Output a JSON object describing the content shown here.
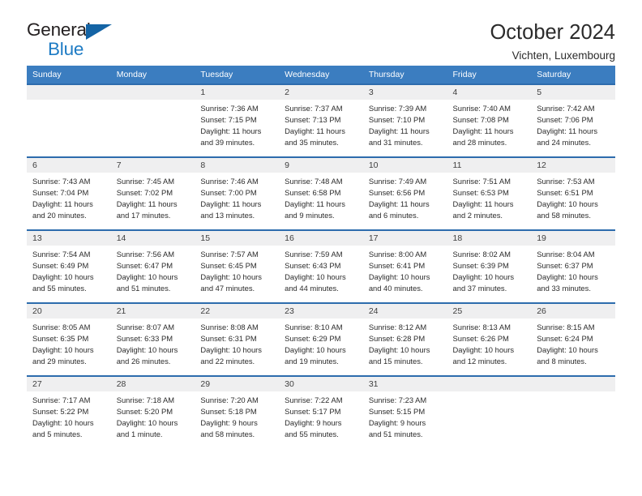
{
  "brand": {
    "name_part1": "General",
    "name_part2": "Blue",
    "triangle_icon": "triangle-icon",
    "accent_color": "#1e7bc4"
  },
  "header": {
    "title": "October 2024",
    "subtitle": "Vichten, Luxembourg"
  },
  "colors": {
    "header_row_bg": "#3b7dc0",
    "row_border": "#2d6cad",
    "daynum_band_bg": "#efeff0",
    "text": "#2b2b2b"
  },
  "weekday_headers": [
    "Sunday",
    "Monday",
    "Tuesday",
    "Wednesday",
    "Thursday",
    "Friday",
    "Saturday"
  ],
  "weeks": [
    [
      {
        "day": "",
        "sunrise": "",
        "sunset": "",
        "daylight_line1": "",
        "daylight_line2": ""
      },
      {
        "day": "",
        "sunrise": "",
        "sunset": "",
        "daylight_line1": "",
        "daylight_line2": ""
      },
      {
        "day": "1",
        "sunrise": "Sunrise: 7:36 AM",
        "sunset": "Sunset: 7:15 PM",
        "daylight_line1": "Daylight: 11 hours",
        "daylight_line2": "and 39 minutes."
      },
      {
        "day": "2",
        "sunrise": "Sunrise: 7:37 AM",
        "sunset": "Sunset: 7:13 PM",
        "daylight_line1": "Daylight: 11 hours",
        "daylight_line2": "and 35 minutes."
      },
      {
        "day": "3",
        "sunrise": "Sunrise: 7:39 AM",
        "sunset": "Sunset: 7:10 PM",
        "daylight_line1": "Daylight: 11 hours",
        "daylight_line2": "and 31 minutes."
      },
      {
        "day": "4",
        "sunrise": "Sunrise: 7:40 AM",
        "sunset": "Sunset: 7:08 PM",
        "daylight_line1": "Daylight: 11 hours",
        "daylight_line2": "and 28 minutes."
      },
      {
        "day": "5",
        "sunrise": "Sunrise: 7:42 AM",
        "sunset": "Sunset: 7:06 PM",
        "daylight_line1": "Daylight: 11 hours",
        "daylight_line2": "and 24 minutes."
      }
    ],
    [
      {
        "day": "6",
        "sunrise": "Sunrise: 7:43 AM",
        "sunset": "Sunset: 7:04 PM",
        "daylight_line1": "Daylight: 11 hours",
        "daylight_line2": "and 20 minutes."
      },
      {
        "day": "7",
        "sunrise": "Sunrise: 7:45 AM",
        "sunset": "Sunset: 7:02 PM",
        "daylight_line1": "Daylight: 11 hours",
        "daylight_line2": "and 17 minutes."
      },
      {
        "day": "8",
        "sunrise": "Sunrise: 7:46 AM",
        "sunset": "Sunset: 7:00 PM",
        "daylight_line1": "Daylight: 11 hours",
        "daylight_line2": "and 13 minutes."
      },
      {
        "day": "9",
        "sunrise": "Sunrise: 7:48 AM",
        "sunset": "Sunset: 6:58 PM",
        "daylight_line1": "Daylight: 11 hours",
        "daylight_line2": "and 9 minutes."
      },
      {
        "day": "10",
        "sunrise": "Sunrise: 7:49 AM",
        "sunset": "Sunset: 6:56 PM",
        "daylight_line1": "Daylight: 11 hours",
        "daylight_line2": "and 6 minutes."
      },
      {
        "day": "11",
        "sunrise": "Sunrise: 7:51 AM",
        "sunset": "Sunset: 6:53 PM",
        "daylight_line1": "Daylight: 11 hours",
        "daylight_line2": "and 2 minutes."
      },
      {
        "day": "12",
        "sunrise": "Sunrise: 7:53 AM",
        "sunset": "Sunset: 6:51 PM",
        "daylight_line1": "Daylight: 10 hours",
        "daylight_line2": "and 58 minutes."
      }
    ],
    [
      {
        "day": "13",
        "sunrise": "Sunrise: 7:54 AM",
        "sunset": "Sunset: 6:49 PM",
        "daylight_line1": "Daylight: 10 hours",
        "daylight_line2": "and 55 minutes."
      },
      {
        "day": "14",
        "sunrise": "Sunrise: 7:56 AM",
        "sunset": "Sunset: 6:47 PM",
        "daylight_line1": "Daylight: 10 hours",
        "daylight_line2": "and 51 minutes."
      },
      {
        "day": "15",
        "sunrise": "Sunrise: 7:57 AM",
        "sunset": "Sunset: 6:45 PM",
        "daylight_line1": "Daylight: 10 hours",
        "daylight_line2": "and 47 minutes."
      },
      {
        "day": "16",
        "sunrise": "Sunrise: 7:59 AM",
        "sunset": "Sunset: 6:43 PM",
        "daylight_line1": "Daylight: 10 hours",
        "daylight_line2": "and 44 minutes."
      },
      {
        "day": "17",
        "sunrise": "Sunrise: 8:00 AM",
        "sunset": "Sunset: 6:41 PM",
        "daylight_line1": "Daylight: 10 hours",
        "daylight_line2": "and 40 minutes."
      },
      {
        "day": "18",
        "sunrise": "Sunrise: 8:02 AM",
        "sunset": "Sunset: 6:39 PM",
        "daylight_line1": "Daylight: 10 hours",
        "daylight_line2": "and 37 minutes."
      },
      {
        "day": "19",
        "sunrise": "Sunrise: 8:04 AM",
        "sunset": "Sunset: 6:37 PM",
        "daylight_line1": "Daylight: 10 hours",
        "daylight_line2": "and 33 minutes."
      }
    ],
    [
      {
        "day": "20",
        "sunrise": "Sunrise: 8:05 AM",
        "sunset": "Sunset: 6:35 PM",
        "daylight_line1": "Daylight: 10 hours",
        "daylight_line2": "and 29 minutes."
      },
      {
        "day": "21",
        "sunrise": "Sunrise: 8:07 AM",
        "sunset": "Sunset: 6:33 PM",
        "daylight_line1": "Daylight: 10 hours",
        "daylight_line2": "and 26 minutes."
      },
      {
        "day": "22",
        "sunrise": "Sunrise: 8:08 AM",
        "sunset": "Sunset: 6:31 PM",
        "daylight_line1": "Daylight: 10 hours",
        "daylight_line2": "and 22 minutes."
      },
      {
        "day": "23",
        "sunrise": "Sunrise: 8:10 AM",
        "sunset": "Sunset: 6:29 PM",
        "daylight_line1": "Daylight: 10 hours",
        "daylight_line2": "and 19 minutes."
      },
      {
        "day": "24",
        "sunrise": "Sunrise: 8:12 AM",
        "sunset": "Sunset: 6:28 PM",
        "daylight_line1": "Daylight: 10 hours",
        "daylight_line2": "and 15 minutes."
      },
      {
        "day": "25",
        "sunrise": "Sunrise: 8:13 AM",
        "sunset": "Sunset: 6:26 PM",
        "daylight_line1": "Daylight: 10 hours",
        "daylight_line2": "and 12 minutes."
      },
      {
        "day": "26",
        "sunrise": "Sunrise: 8:15 AM",
        "sunset": "Sunset: 6:24 PM",
        "daylight_line1": "Daylight: 10 hours",
        "daylight_line2": "and 8 minutes."
      }
    ],
    [
      {
        "day": "27",
        "sunrise": "Sunrise: 7:17 AM",
        "sunset": "Sunset: 5:22 PM",
        "daylight_line1": "Daylight: 10 hours",
        "daylight_line2": "and 5 minutes."
      },
      {
        "day": "28",
        "sunrise": "Sunrise: 7:18 AM",
        "sunset": "Sunset: 5:20 PM",
        "daylight_line1": "Daylight: 10 hours",
        "daylight_line2": "and 1 minute."
      },
      {
        "day": "29",
        "sunrise": "Sunrise: 7:20 AM",
        "sunset": "Sunset: 5:18 PM",
        "daylight_line1": "Daylight: 9 hours",
        "daylight_line2": "and 58 minutes."
      },
      {
        "day": "30",
        "sunrise": "Sunrise: 7:22 AM",
        "sunset": "Sunset: 5:17 PM",
        "daylight_line1": "Daylight: 9 hours",
        "daylight_line2": "and 55 minutes."
      },
      {
        "day": "31",
        "sunrise": "Sunrise: 7:23 AM",
        "sunset": "Sunset: 5:15 PM",
        "daylight_line1": "Daylight: 9 hours",
        "daylight_line2": "and 51 minutes."
      },
      {
        "day": "",
        "sunrise": "",
        "sunset": "",
        "daylight_line1": "",
        "daylight_line2": ""
      },
      {
        "day": "",
        "sunrise": "",
        "sunset": "",
        "daylight_line1": "",
        "daylight_line2": ""
      }
    ]
  ]
}
